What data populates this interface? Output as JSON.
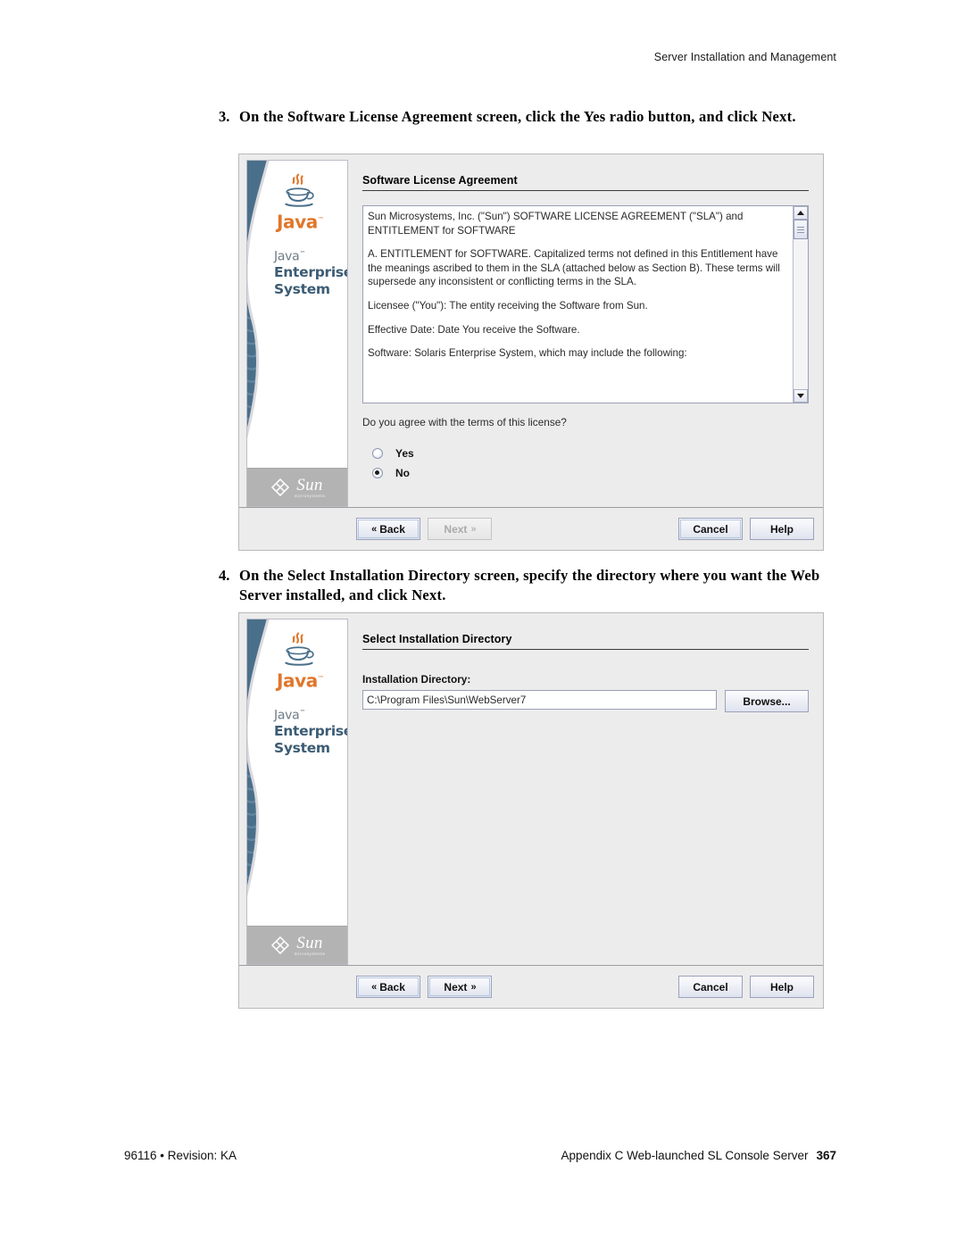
{
  "header": {
    "running_head": "Server Installation and Management"
  },
  "footer": {
    "left": "96116 • Revision: KA",
    "right": "Appendix C Web-launched SL Console Server",
    "page_number": "367"
  },
  "steps": [
    {
      "number": "3.",
      "text": "On the Software License Agreement screen, click the Yes radio button, and click Next."
    },
    {
      "number": "4.",
      "text": "On the Select Installation Directory screen, specify the directory where you want the Web Server installed, and click Next."
    }
  ],
  "banner": {
    "java_wordmark": "Java",
    "java_tm": "™",
    "product_line1": "Java",
    "product_tm": "™",
    "product_line2": "Enterprise",
    "product_line3": "System",
    "sun_name": "Sun",
    "sun_sub": "microsystems",
    "colors": {
      "java_orange": "#e0762a",
      "wave_blue": "#4a6f8a",
      "jes_blue": "#3c5c74",
      "jes_grey": "#6f7c86",
      "footer_grey": "#b3b3b3"
    }
  },
  "dialog_license": {
    "title": "Software License Agreement",
    "license_paragraphs": [
      "Sun Microsystems, Inc. (\"Sun\") SOFTWARE LICENSE AGREEMENT (\"SLA\") and ENTITLEMENT for SOFTWARE",
      "A. ENTITLEMENT for SOFTWARE. Capitalized terms not defined in this Entitlement have the meanings ascribed to them in the SLA (attached below as Section B).  These terms will supersede any inconsistent or conflicting terms in the SLA.",
      "Licensee (\"You\"): The entity receiving the Software from Sun.",
      "Effective Date: Date You receive the Software.",
      "Software: Solaris Enterprise System, which may include the following:"
    ],
    "question": "Do you agree with the terms of this license?",
    "radios": [
      {
        "label": "Yes",
        "selected": false
      },
      {
        "label": "No",
        "selected": true
      }
    ],
    "buttons": {
      "back": "Back",
      "next": "Next",
      "cancel": "Cancel",
      "help": "Help",
      "next_enabled": false
    }
  },
  "dialog_directory": {
    "title": "Select Installation Directory",
    "field_label": "Installation Directory:",
    "field_value": "C:\\Program Files\\Sun\\WebServer7",
    "browse_label": "Browse...",
    "buttons": {
      "back": "Back",
      "next": "Next",
      "cancel": "Cancel",
      "help": "Help",
      "next_enabled": true
    }
  },
  "icons": {
    "chevron_left": "«",
    "chevron_right": "»"
  }
}
